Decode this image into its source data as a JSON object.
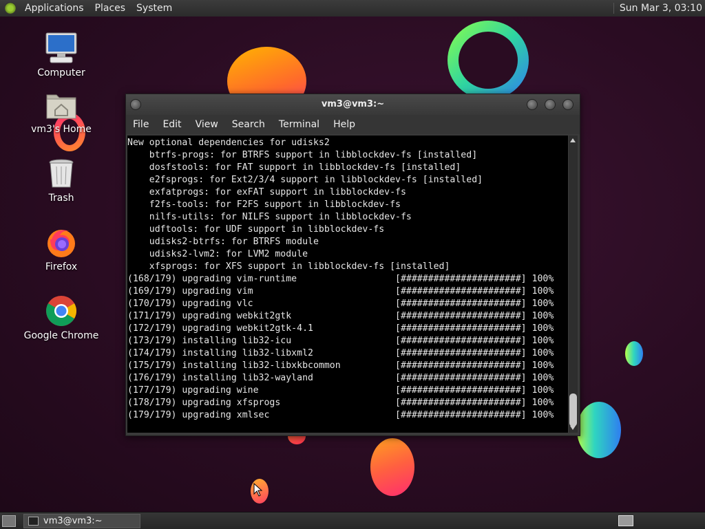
{
  "top_panel": {
    "menus": [
      "Applications",
      "Places",
      "System"
    ],
    "clock": "Sun Mar  3, 03:10"
  },
  "desktop_icons": [
    {
      "label": "Computer",
      "icon": "computer-icon"
    },
    {
      "label": "vm3's Home",
      "icon": "home-folder-icon"
    },
    {
      "label": "Trash",
      "icon": "trash-icon"
    },
    {
      "label": "Firefox",
      "icon": "firefox-icon"
    },
    {
      "label": "Google Chrome",
      "icon": "chrome-icon"
    }
  ],
  "terminal": {
    "title": "vm3@vm3:~",
    "menu": [
      "File",
      "Edit",
      "View",
      "Search",
      "Terminal",
      "Help"
    ],
    "output": "New optional dependencies for udisks2\n    btrfs-progs: for BTRFS support in libblockdev-fs [installed]\n    dosfstools: for FAT support in libblockdev-fs [installed]\n    e2fsprogs: for Ext2/3/4 support in libblockdev-fs [installed]\n    exfatprogs: for exFAT support in libblockdev-fs\n    f2fs-tools: for F2FS support in libblockdev-fs\n    nilfs-utils: for NILFS support in libblockdev-fs\n    udftools: for UDF support in libblockdev-fs\n    udisks2-btrfs: for BTRFS module\n    udisks2-lvm2: for LVM2 module\n    xfsprogs: for XFS support in libblockdev-fs [installed]\n(168/179) upgrading vim-runtime                  [######################] 100%\n(169/179) upgrading vim                          [######################] 100%\n(170/179) upgrading vlc                          [######################] 100%\n(171/179) upgrading webkit2gtk                   [######################] 100%\n(172/179) upgrading webkit2gtk-4.1               [######################] 100%\n(173/179) installing lib32-icu                   [######################] 100%\n(174/179) installing lib32-libxml2               [######################] 100%\n(175/179) installing lib32-libxkbcommon          [######################] 100%\n(176/179) installing lib32-wayland               [######################] 100%\n(177/179) upgrading wine                         [######################] 100%\n(178/179) upgrading xfsprogs                     [######################] 100%\n(179/179) upgrading xmlsec                       [######################] 100%"
  },
  "taskbar": {
    "window_button": "vm3@vm3:~"
  }
}
